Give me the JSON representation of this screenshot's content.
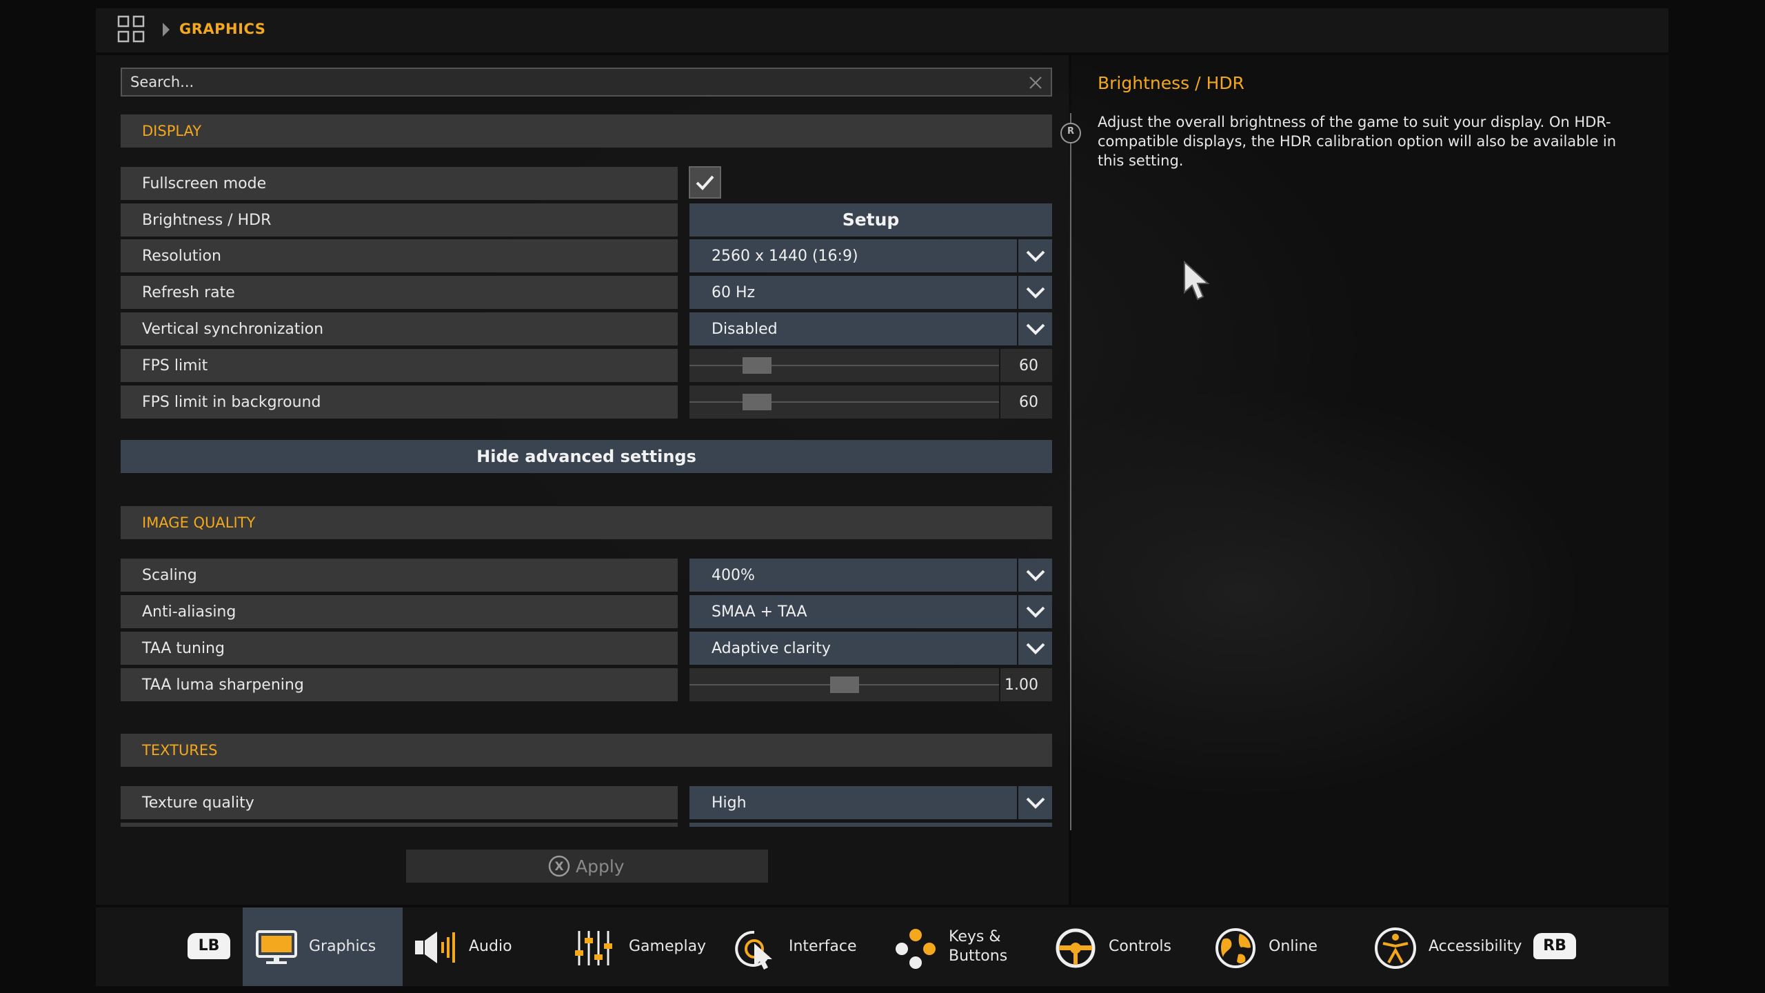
{
  "breadcrumb": {
    "current": "GRAPHICS"
  },
  "search": {
    "placeholder": "Search..."
  },
  "sections": {
    "display": "DISPLAY",
    "image_quality": "IMAGE QUALITY",
    "textures": "TEXTURES"
  },
  "settings": {
    "fullscreen": {
      "label": "Fullscreen mode",
      "checked": true
    },
    "brightness": {
      "label": "Brightness / HDR",
      "button": "Setup"
    },
    "resolution": {
      "label": "Resolution",
      "value": "2560 x 1440 (16:9)"
    },
    "refresh_rate": {
      "label": "Refresh rate",
      "value": "60 Hz"
    },
    "vsync": {
      "label": "Vertical synchronization",
      "value": "Disabled"
    },
    "fps_limit": {
      "label": "FPS limit",
      "value": "60",
      "fraction": 0.19
    },
    "fps_limit_bg": {
      "label": "FPS limit in background",
      "value": "60",
      "fraction": 0.19
    },
    "advanced_toggle": "Hide advanced settings",
    "scaling": {
      "label": "Scaling",
      "value": "400%"
    },
    "anti_aliasing": {
      "label": "Anti-aliasing",
      "value": "SMAA + TAA"
    },
    "taa_tuning": {
      "label": "TAA tuning",
      "value": "Adaptive clarity"
    },
    "taa_sharpening": {
      "label": "TAA luma sharpening",
      "value": "1.00",
      "fraction": 0.5
    },
    "texture_quality": {
      "label": "Texture quality",
      "value": "High"
    }
  },
  "apply": {
    "label": "Apply",
    "icon": "X"
  },
  "info": {
    "title": "Brightness / HDR",
    "text": "Adjust the overall brightness of the game to suit your display. On HDR-compatible displays, the HDR calibration option will also be available in this setting."
  },
  "scroll_marker": "R",
  "nav": {
    "lb": "LB",
    "rb": "RB",
    "tabs": [
      {
        "label": "Graphics",
        "icon": "monitor-icon",
        "active": true
      },
      {
        "label": "Audio",
        "icon": "speaker-icon"
      },
      {
        "label": "Gameplay",
        "icon": "sliders-icon"
      },
      {
        "label": "Interface",
        "icon": "pointer-icon"
      },
      {
        "label": "Keys &",
        "label2": "Buttons",
        "icon": "buttons-icon"
      },
      {
        "label": "Controls",
        "icon": "steering-wheel-icon"
      },
      {
        "label": "Online",
        "icon": "globe-icon"
      },
      {
        "label": "Accessibility",
        "icon": "accessibility-icon"
      }
    ]
  },
  "colors": {
    "accent": "#f3a81d",
    "control": "#3a4450",
    "row": "#383838"
  }
}
